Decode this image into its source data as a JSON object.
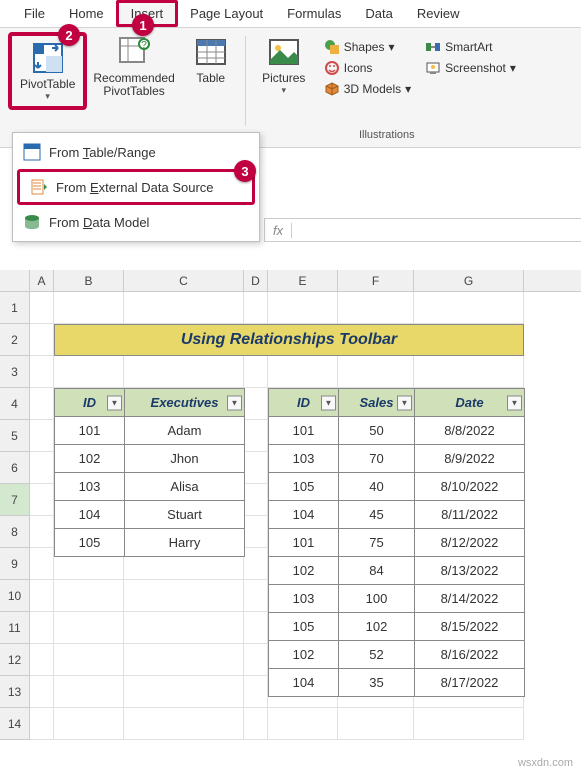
{
  "tabs": [
    "File",
    "Home",
    "Insert",
    "Page Layout",
    "Formulas",
    "Data",
    "Review"
  ],
  "active_tab": "Insert",
  "ribbon": {
    "pivottable": "PivotTable",
    "recommended": "Recommended\nPivotTables",
    "table": "Table",
    "pictures": "Pictures",
    "shapes": "Shapes",
    "icons": "Icons",
    "models": "3D Models",
    "smartart": "SmartArt",
    "screenshot": "Screenshot",
    "group_illustrations": "Illustrations"
  },
  "dropdown": {
    "item1_pre": "From ",
    "item1_u": "T",
    "item1_post": "able/Range",
    "item2_full": "From External Data Source",
    "item2_pre": "From ",
    "item2_u": "E",
    "item2_post": "xternal Data Source",
    "item3_pre": "From ",
    "item3_u": "D",
    "item3_post": "ata Model"
  },
  "callouts": {
    "one": "1",
    "two": "2",
    "three": "3"
  },
  "fx_label": "fx",
  "columns": [
    "A",
    "B",
    "C",
    "D",
    "E",
    "F",
    "G"
  ],
  "rownums": [
    "1",
    "2",
    "3",
    "4",
    "5",
    "6",
    "7",
    "8",
    "9",
    "10",
    "11",
    "12",
    "13",
    "14"
  ],
  "banner_text": "Using Relationships Toolbar",
  "table1": {
    "headers": [
      "ID",
      "Executives"
    ],
    "rows": [
      [
        "101",
        "Adam"
      ],
      [
        "102",
        "Jhon"
      ],
      [
        "103",
        "Alisa"
      ],
      [
        "104",
        "Stuart"
      ],
      [
        "105",
        "Harry"
      ]
    ]
  },
  "table2": {
    "headers": [
      "ID",
      "Sales",
      "Date"
    ],
    "rows": [
      [
        "101",
        "50",
        "8/8/2022"
      ],
      [
        "103",
        "70",
        "8/9/2022"
      ],
      [
        "105",
        "40",
        "8/10/2022"
      ],
      [
        "104",
        "45",
        "8/11/2022"
      ],
      [
        "101",
        "75",
        "8/12/2022"
      ],
      [
        "102",
        "84",
        "8/13/2022"
      ],
      [
        "103",
        "100",
        "8/14/2022"
      ],
      [
        "105",
        "102",
        "8/15/2022"
      ],
      [
        "102",
        "52",
        "8/16/2022"
      ],
      [
        "104",
        "35",
        "8/17/2022"
      ]
    ]
  },
  "watermark": "wsxdn.com"
}
